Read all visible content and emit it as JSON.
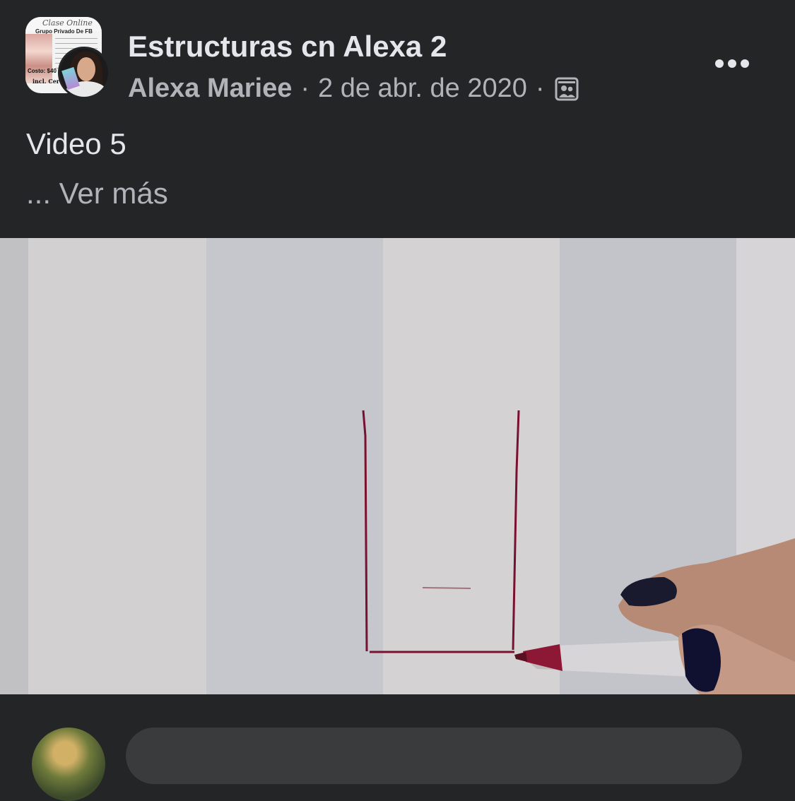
{
  "post": {
    "group_name": "Estructuras cn Alexa 2",
    "author": "Alexa Mariee",
    "separator": "·",
    "date": "2 de abr. de 2020",
    "text": "Video 5",
    "see_more": "... Ver más"
  },
  "group_avatar_flyer": {
    "title": "Clase Online",
    "subtitle": "Grupo Privado De FB",
    "cost": "Costo: $40",
    "includes": "incl. Certificado"
  },
  "icons": {
    "privacy": "members-group-icon",
    "more": "more-options-icon"
  },
  "colors": {
    "background": "#242526",
    "primary_text": "#e4e6eb",
    "secondary_text": "#b0b3b8",
    "comment_box": "#3a3b3c",
    "marker_line": "#7a1030"
  }
}
